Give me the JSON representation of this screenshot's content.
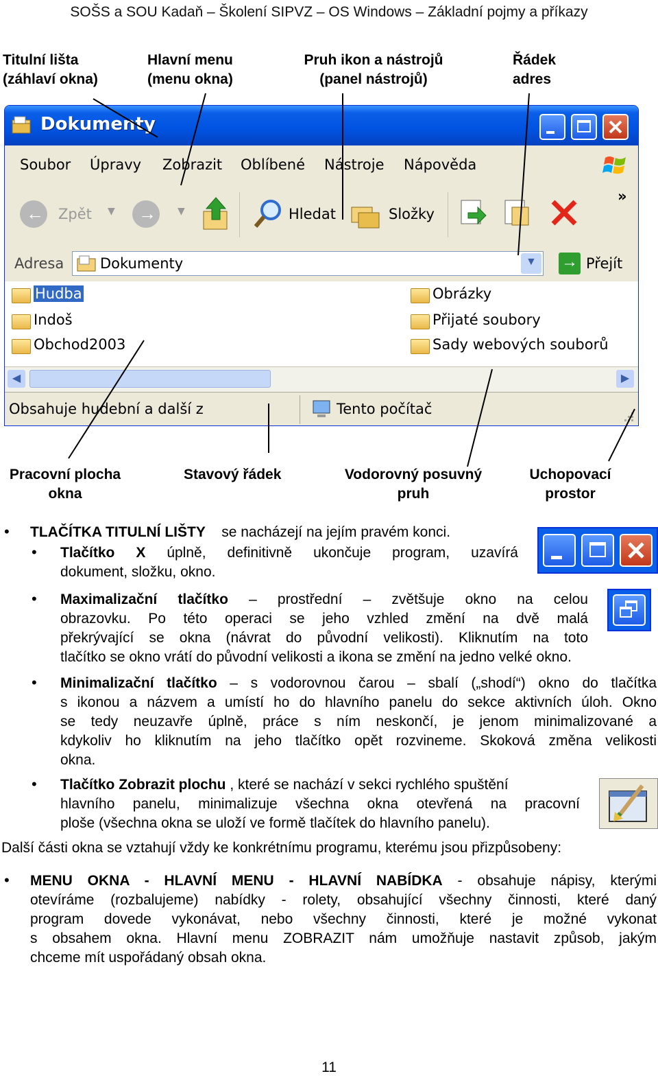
{
  "header": "SOŠS a SOU Kadaň – Školení SIPVZ – OS Windows – Základní pojmy a příkazy",
  "labels_top": {
    "title_bar": [
      "Titulní lišta",
      "(záhlaví okna)"
    ],
    "main_menu": [
      "Hlavní menu",
      "(menu okna)"
    ],
    "toolbar": [
      "Pruh ikon  a nástrojů",
      "(panel nástrojů)"
    ],
    "address": [
      "Řádek",
      "adres"
    ]
  },
  "window": {
    "title": "Dokumenty",
    "menu": [
      "Soubor",
      "Úpravy",
      "Zobrazit",
      "Oblíbené",
      "Nástroje",
      "Nápověda"
    ],
    "toolbar": {
      "back": "Zpět",
      "search": "Hledat",
      "folders": "Složky"
    },
    "address_label": "Adresa",
    "address_value": "Dokumenty",
    "go": "Přejít",
    "items_left": [
      "Hudba",
      "Indoš",
      "Obchod2003"
    ],
    "items_right": [
      "Obrázky",
      "Přijaté soubory",
      "Sady webových souborů"
    ],
    "status_left": "Obsahuje hudební a další z",
    "status_right": "Tento počítač"
  },
  "labels_bottom": {
    "workspace": [
      "Pracovní plocha",
      "okna"
    ],
    "statusbar": [
      "Stavový řádek"
    ],
    "hscroll": [
      "Vodorovný  posuvný",
      "pruh"
    ],
    "grip": [
      "Uchopovací",
      "prostor"
    ]
  },
  "text": {
    "b1_head": "TLAČÍTKA TITULNÍ LIŠTY",
    "b1_rest": "se nacházejí na jejím pravém konci.",
    "b2_head": "Tlačítko  X",
    "b2_rest": "úplně,  definitivně  ukončuje  program,  uzavírá",
    "b2_line2": "dokument, složku, okno.",
    "b3_head": "Maximalizační  tlačítko",
    "b3_rest": "–  prostřední  –  zvětšuje  okno  na  celou",
    "b3_line2": "obrazovku.  Po  této  operaci  se  jeho  vzhled  změní  na  dvě  malá",
    "b3_line3": "překrývající  se  okna   (návrat  do  původní  velikosti).  Kliknutím  na  toto",
    "b3_line4": "tlačítko se okno vrátí do původní velikosti a ikona se změní na jedno velké okno.",
    "b4_head": "Minimalizační  tlačítko",
    "b4_rest": "– s vodorovnou čarou – sbalí („shodí“) okno do tlačítka",
    "b4_line2": "s ikonou a názvem a umístí ho do hlavního panelu do sekce aktivních úloh. Okno",
    "b4_line3": "se  tedy  neuzavře  úplně,  práce  s ním  neskončí,  je  jenom  minimalizované  a",
    "b4_line4": "kdykoliv  ho  kliknutím  na  jeho  tlačítko  opět  rozvineme.  Skoková  změna  velikosti",
    "b4_line5": "okna.",
    "b5_head": "Tlačítko Zobrazit plochu",
    "b5_rest": " , které se nachází v sekci rychlého spuštění",
    "b5_line2": "hlavního  panelu,  minimalizuje  všechna  okna  otevřená  na  pracovní",
    "b5_line3": "ploše (všechna okna se uloží ve formě tlačítek do hlavního panelu).",
    "para": "Další části okna se vztahují vždy ke konkrétnímu programu, kterému jsou přizpůsobeny:",
    "b6_head": "MENU  OKNA  -  HLAVNÍ  MENU  -  HLAVNÍ  NABÍDKA",
    "b6_rest": " -  obsahuje  nápisy,  kterými",
    "b6_line2": "otevíráme  (rozbalujeme)  nabídky  -  rolety,  obsahující  všechny  činnosti,  které  daný",
    "b6_line3": "program   dovede   vykonávat,   nebo   všechny   činnosti,   které   je   možné   vykonat",
    "b6_line4": "s obsahem  okna.  Hlavní  menu  ZOBRAZIT  nám  umožňuje  nastavit  způsob,  jakým",
    "b6_line5": "chceme mít uspořádaný obsah okna."
  },
  "page_number": "11"
}
